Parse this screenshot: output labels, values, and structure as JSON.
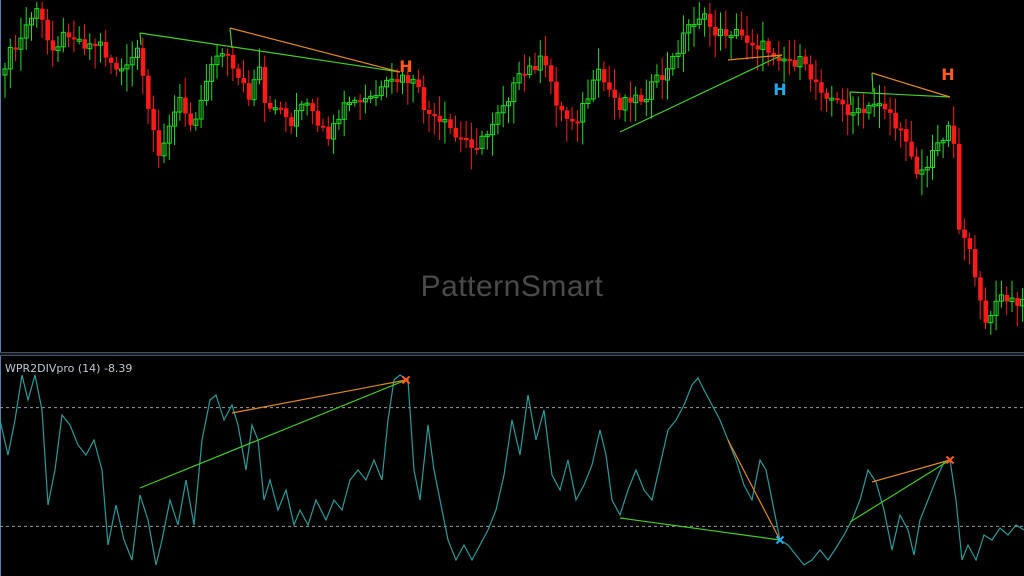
{
  "watermark": "PatternSmart",
  "indicator": {
    "name": "WPR2DIVpro (14)",
    "value": "-8.39"
  },
  "colors": {
    "bull": "#22dd22",
    "bear": "#ff1a1a",
    "line_green": "#44cc22",
    "line_orange": "#e08a1e",
    "wpr_line": "#2a9a9a",
    "H_orange": "#ff5a1f",
    "H_blue": "#22aaee",
    "level": "#9a9a9a"
  },
  "chart_data": {
    "type": "candlestick+line",
    "main": {
      "h_labels": [
        {
          "text": "H",
          "color": "orange"
        },
        {
          "text": "H",
          "color": "blue"
        },
        {
          "text": "H",
          "color": "orange"
        }
      ]
    },
    "indicator": {
      "ylim": [
        -100,
        0
      ],
      "levels": [
        -20,
        -80
      ],
      "markers": [
        {
          "symbol": "x",
          "color": "orange"
        },
        {
          "symbol": "x",
          "color": "blue"
        },
        {
          "symbol": "x",
          "color": "orange"
        }
      ]
    }
  }
}
